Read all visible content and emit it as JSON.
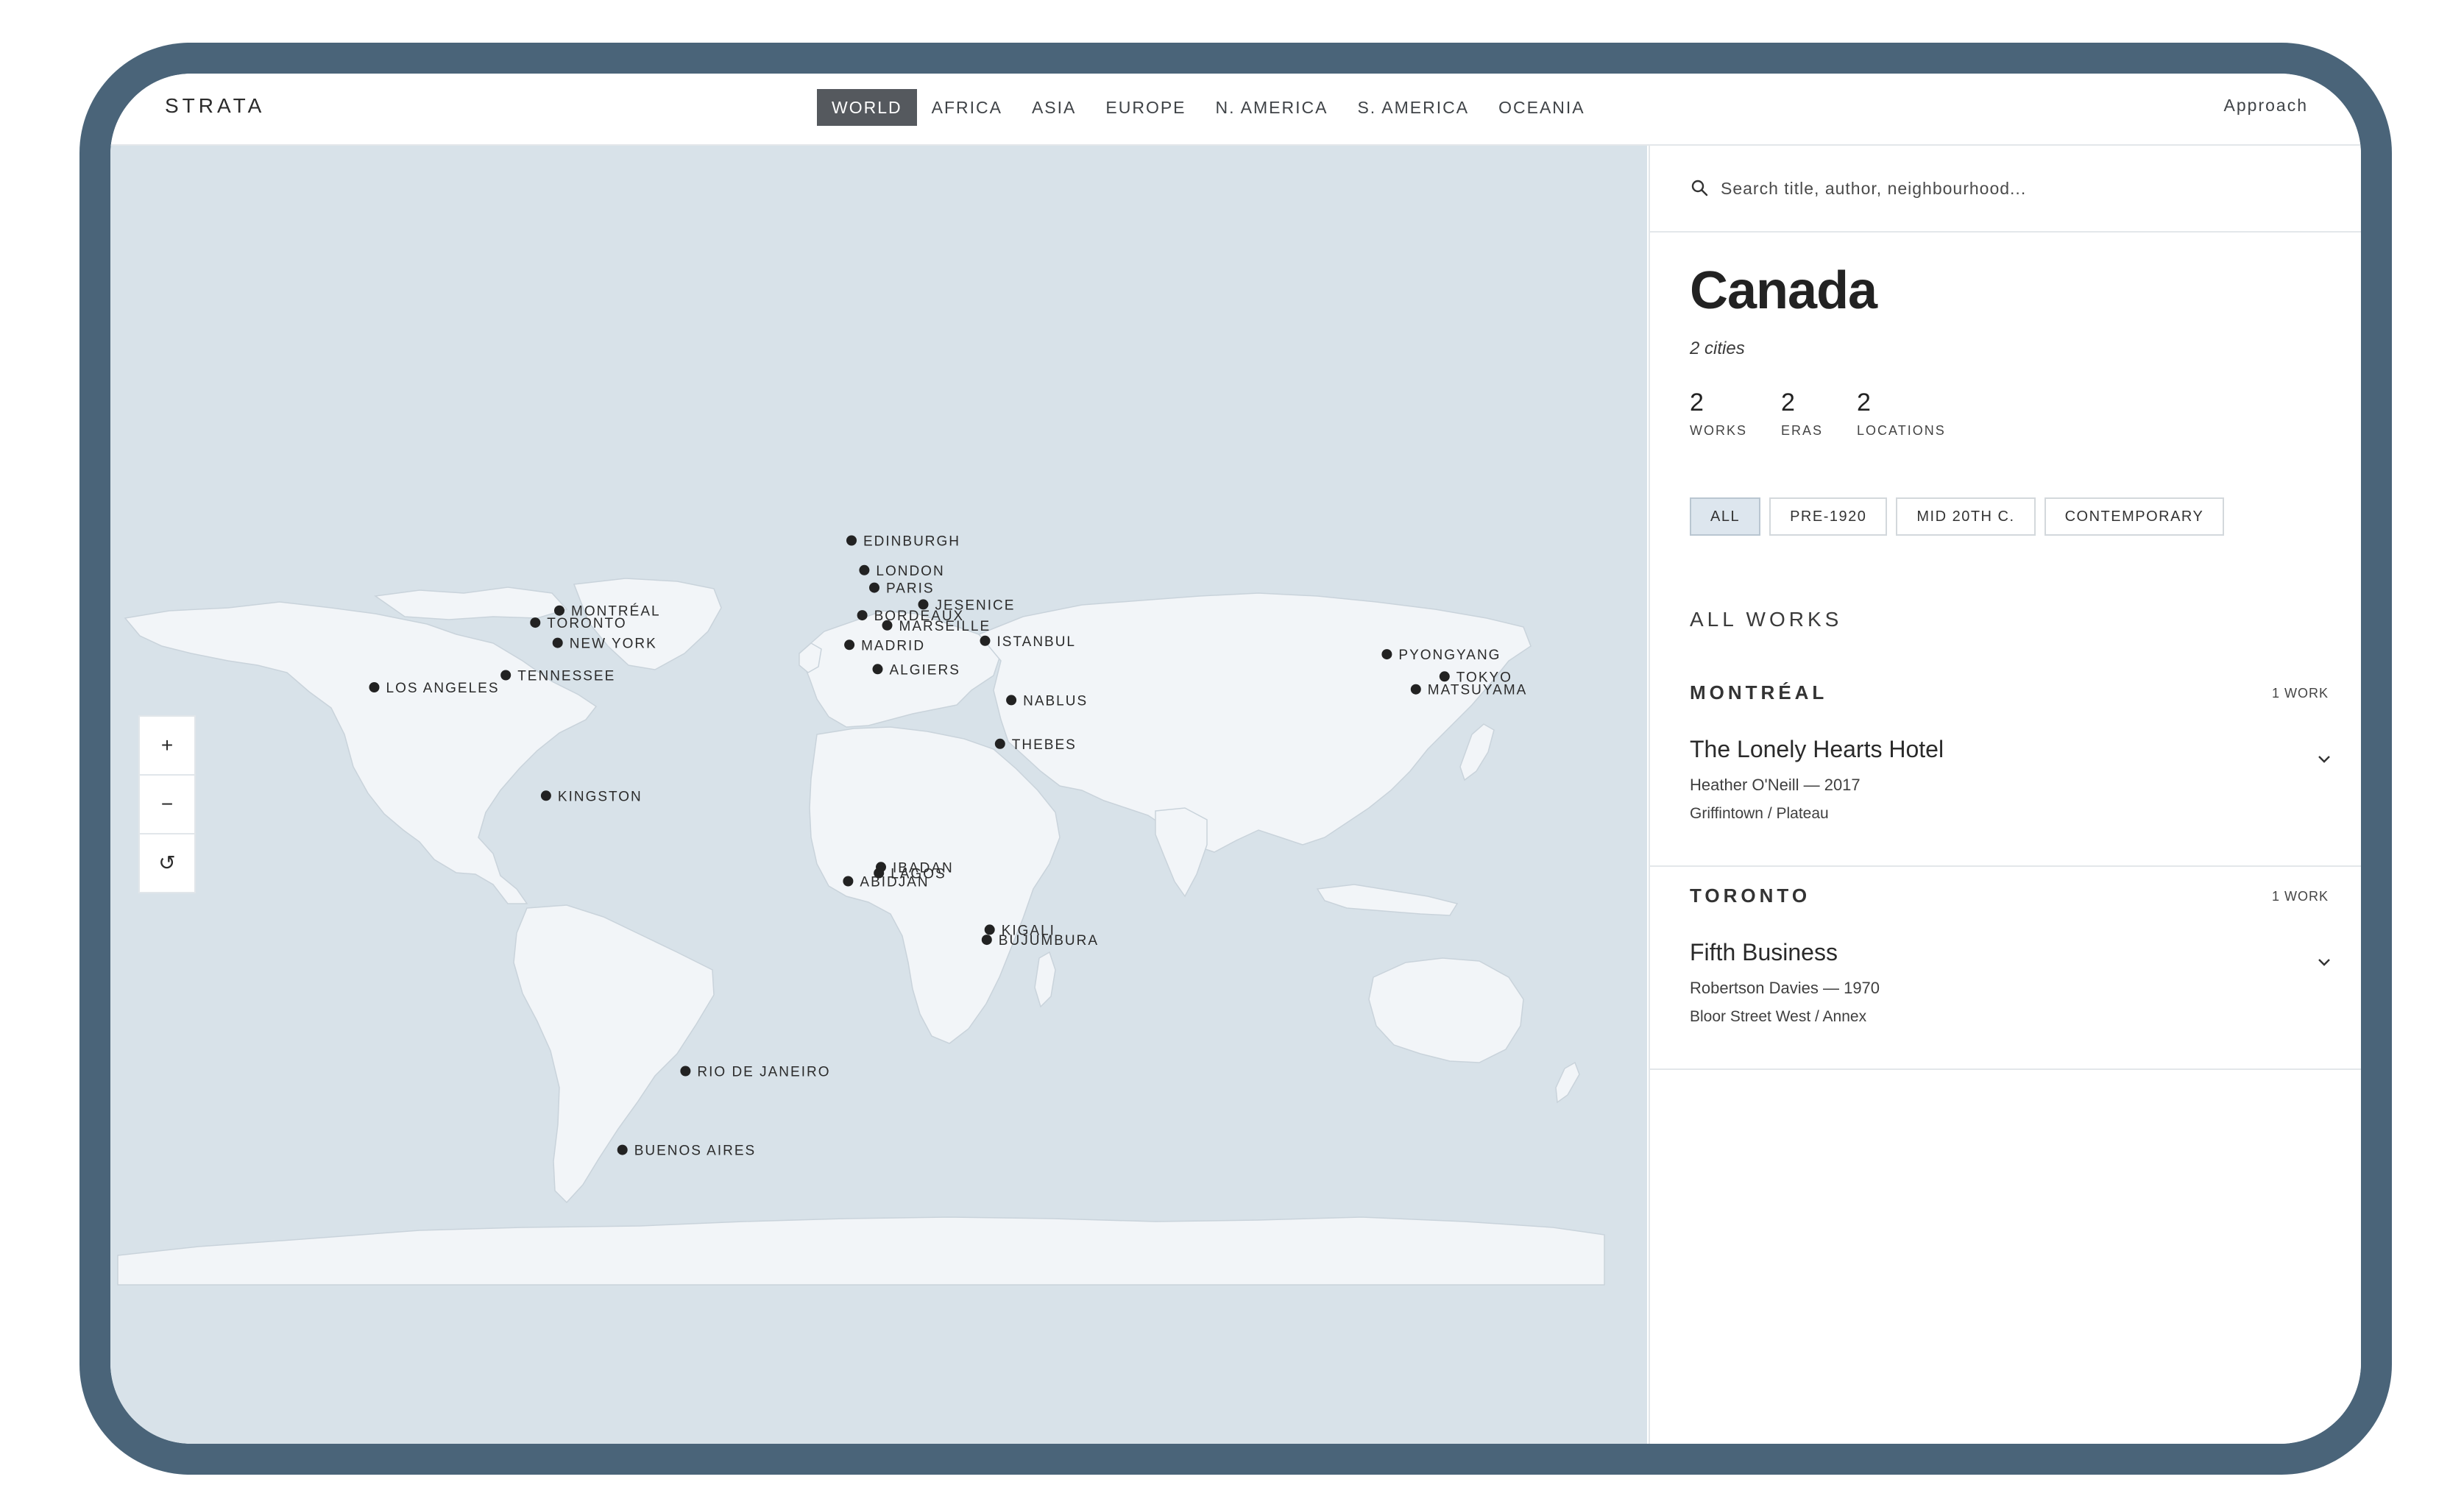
{
  "header": {
    "brand": "STRATA",
    "nav": [
      "WORLD",
      "AFRICA",
      "ASIA",
      "EUROPE",
      "N. AMERICA",
      "S. AMERICA",
      "OCEANIA"
    ],
    "active_nav": "WORLD",
    "approach": "Approach"
  },
  "map": {
    "zoom_in": "+",
    "zoom_out": "−",
    "reset": "↺",
    "cities": [
      {
        "name": "EDINBURGH",
        "lon": -3.2,
        "lat": 55.9
      },
      {
        "name": "LONDON",
        "lon": -0.1,
        "lat": 51.5
      },
      {
        "name": "BORDEAUX",
        "lon": -0.6,
        "lat": 44.8
      },
      {
        "name": "PARIS",
        "lon": 2.3,
        "lat": 48.9
      },
      {
        "name": "JESENICE",
        "lon": 14.1,
        "lat": 46.4
      },
      {
        "name": "MARSEILLE",
        "lon": 5.4,
        "lat": 43.3
      },
      {
        "name": "ISTANBUL",
        "lon": 29.0,
        "lat": 41.0
      },
      {
        "name": "MADRID",
        "lon": -3.7,
        "lat": 40.4
      },
      {
        "name": "ALGIERS",
        "lon": 3.1,
        "lat": 36.8
      },
      {
        "name": "NABLUS",
        "lon": 35.3,
        "lat": 32.2
      },
      {
        "name": "THEBES",
        "lon": 32.6,
        "lat": 25.7
      },
      {
        "name": "MONTRÉAL",
        "lon": -73.6,
        "lat": 45.5
      },
      {
        "name": "TORONTO",
        "lon": -79.4,
        "lat": 43.7
      },
      {
        "name": "NEW YORK",
        "lon": -74.0,
        "lat": 40.7
      },
      {
        "name": "TENNESSEE",
        "lon": -86.5,
        "lat": 35.9
      },
      {
        "name": "LOS ANGELES",
        "lon": -118.2,
        "lat": 34.1
      },
      {
        "name": "KINGSTON",
        "lon": -76.8,
        "lat": 18.0
      },
      {
        "name": "LAGOS",
        "lon": 3.4,
        "lat": 6.5
      },
      {
        "name": "IBADAN",
        "lon": 3.9,
        "lat": 7.4
      },
      {
        "name": "ABIDJAN",
        "lon": -4.0,
        "lat": 5.3
      },
      {
        "name": "KIGALI",
        "lon": 30.1,
        "lat": -1.9
      },
      {
        "name": "BUJUMBURA",
        "lon": 29.4,
        "lat": -3.4
      },
      {
        "name": "RIO DE JANEIRO",
        "lon": -43.2,
        "lat": -22.9
      },
      {
        "name": "BUENOS AIRES",
        "lon": -58.4,
        "lat": -34.6
      },
      {
        "name": "PYONGYANG",
        "lon": 125.8,
        "lat": 39.0
      },
      {
        "name": "TOKYO",
        "lon": 139.7,
        "lat": 35.7
      },
      {
        "name": "MATSUYAMA",
        "lon": 132.8,
        "lat": 33.8
      }
    ]
  },
  "panel": {
    "search_placeholder": "Search title, author, neighbourhood...",
    "country": "Canada",
    "subtitle": "2 cities",
    "stats": [
      {
        "value": "2",
        "label": "WORKS"
      },
      {
        "value": "2",
        "label": "ERAS"
      },
      {
        "value": "2",
        "label": "LOCATIONS"
      }
    ],
    "filters": [
      "ALL",
      "PRE-1920",
      "MID 20TH C.",
      "CONTEMPORARY"
    ],
    "active_filter": "ALL",
    "section_title": "ALL WORKS",
    "groups": [
      {
        "city": "MONTRÉAL",
        "count": "1 WORK",
        "work": {
          "title": "The Lonely Hearts Hotel",
          "meta": "Heather O'Neill — 2017",
          "location": "Griffintown / Plateau"
        }
      },
      {
        "city": "TORONTO",
        "count": "1 WORK",
        "work": {
          "title": "Fifth Business",
          "meta": "Robertson Davies — 1970",
          "location": "Bloor Street West / Annex"
        }
      }
    ]
  },
  "colors": {
    "frame": "#4a6479",
    "ocean": "#d8e2e9",
    "land": "#f2f5f8",
    "marker": "#222222",
    "active_nav_bg": "#55595e"
  }
}
